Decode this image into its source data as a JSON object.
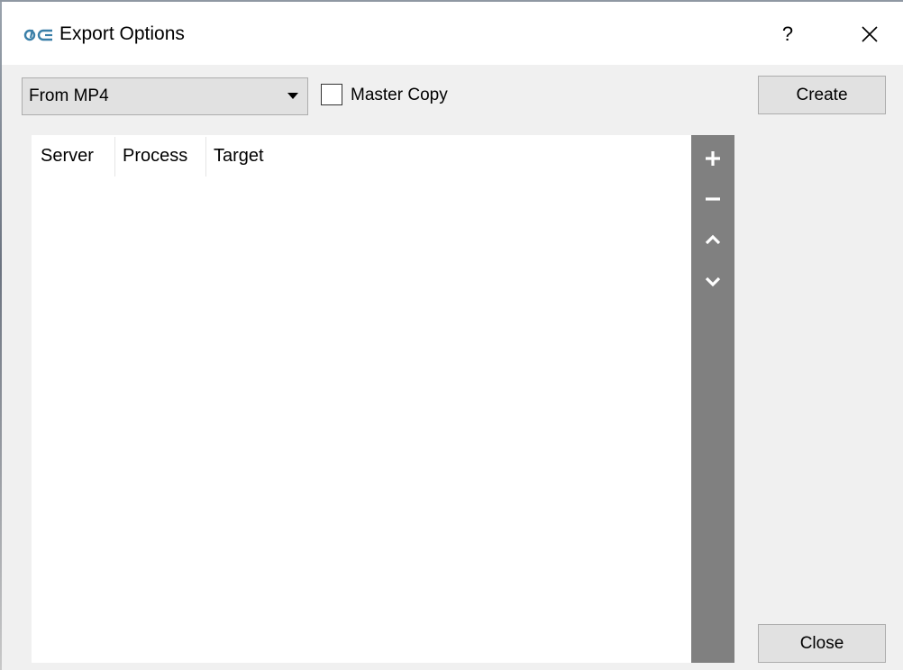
{
  "window": {
    "title": "Export Options",
    "help_label": "?"
  },
  "toolbar": {
    "source_value": "From MP4",
    "master_copy_label": "Master Copy",
    "master_copy_checked": false,
    "create_label": "Create"
  },
  "table": {
    "columns": [
      "Server",
      "Process",
      "Target"
    ],
    "rows": []
  },
  "action_bar": {
    "icons": [
      "plus-icon",
      "minus-icon",
      "chevron-up-icon",
      "chevron-down-icon"
    ]
  },
  "footer": {
    "close_label": "Close"
  },
  "colors": {
    "action_bar": "#808080",
    "button_face": "#e1e1e1",
    "app_icon": "#3a7fa8"
  }
}
